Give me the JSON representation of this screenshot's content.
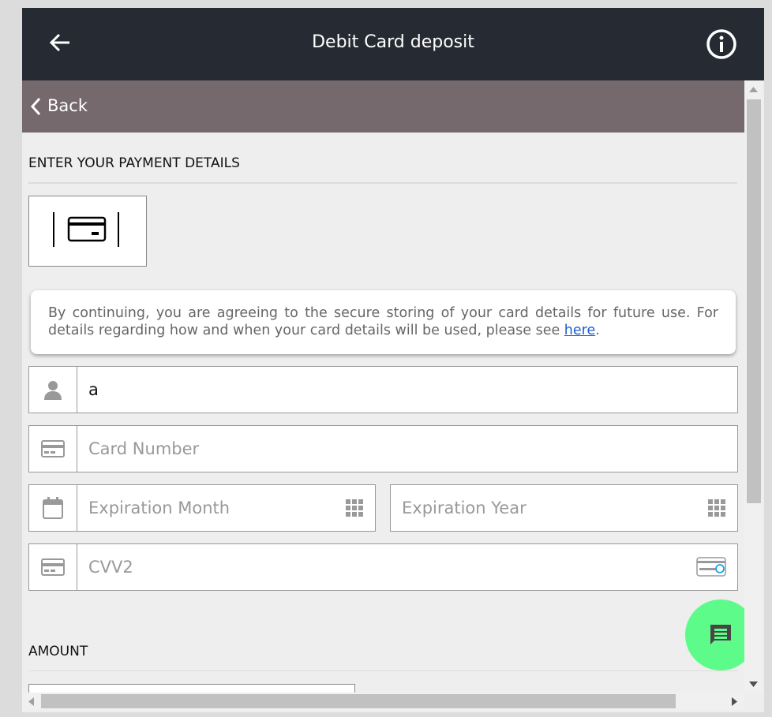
{
  "header": {
    "title": "Debit Card deposit"
  },
  "back_bar": {
    "label": "Back"
  },
  "payment": {
    "section_title": "ENTER YOUR PAYMENT DETAILS"
  },
  "notice": {
    "text": "By continuing, you are agreeing to the secure storing of your card details for future use. For details regarding how and when your card details will be used, please see ",
    "link": "here",
    "end": "."
  },
  "fields": {
    "name": {
      "value": "a"
    },
    "card_number": {
      "placeholder": "Card Number"
    },
    "exp_month": {
      "placeholder": "Expiration Month"
    },
    "exp_year": {
      "placeholder": "Expiration Year"
    },
    "cvv": {
      "placeholder": "CVV2"
    }
  },
  "amount": {
    "section_title": "AMOUNT"
  },
  "colors": {
    "header": "#262a33",
    "back_bar": "#75696e",
    "chat": "#5dfc8a",
    "link": "#1a5fd0"
  }
}
